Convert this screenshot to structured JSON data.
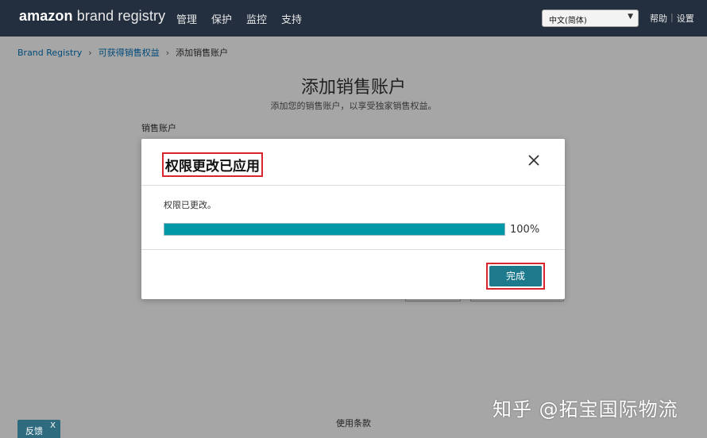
{
  "header": {
    "logo_brand": "amazon",
    "logo_rest": " brand registry",
    "nav": [
      "管理",
      "保护",
      "监控",
      "支持"
    ],
    "language": "中文(简体)",
    "help": "帮助",
    "settings": "设置"
  },
  "breadcrumb": {
    "root": "Brand Registry",
    "parent": "可获得销售权益",
    "current": "添加销售账户"
  },
  "page": {
    "title": "添加销售账户",
    "subtitle": "添加您的销售账户，以享受独家销售权益。",
    "field_label": "销售账户",
    "footer_link": "使用条款",
    "feedback": "反馈",
    "feedback_close": "X"
  },
  "modal": {
    "title": "权限更改已应用",
    "status_text": "权限已更改。",
    "progress_percent": 100,
    "progress_text": "100%",
    "done_button": "完成"
  },
  "watermark": "知乎 @拓宝国际物流",
  "colors": {
    "topbar": "#232f3e",
    "accent": "#0097a7",
    "button": "#1d7a8c",
    "highlight": "#d9262e",
    "link": "#0073bb"
  },
  "icons": {
    "close": "close-icon",
    "dropdown": "chevron-down-icon"
  }
}
